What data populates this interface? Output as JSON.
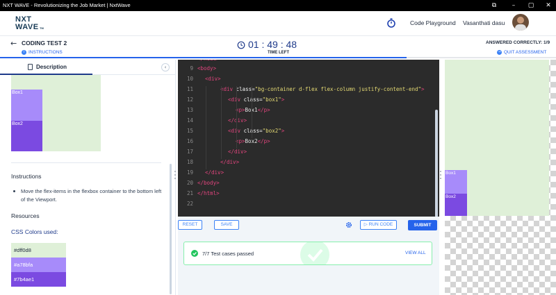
{
  "window": {
    "title": "NXT WAVE - Revolutionizing the Job Market | NxtWave"
  },
  "header": {
    "logo_line1": "NXT",
    "logo_line2": "WAVE",
    "logo_tm": "TM",
    "code_playground": "Code Playground",
    "user_name": "Vasanthati dasu"
  },
  "subheader": {
    "test_title": "CODING TEST 2",
    "instructions_link": "INSTRUCTIONS",
    "timer": "01 : 49 : 48",
    "time_left": "TIME LEFT",
    "answered": "ANSWERED CORRECTLY: 1/9",
    "quit": "QUIT ASSESSMENT"
  },
  "left_panel": {
    "tab_label": "Description",
    "preview_box1": "Box1",
    "preview_box2": "Box2",
    "instructions_title": "Instructions",
    "instruction_text": "Move the flex-items in the flexbox container to the bottom left of the Viewport.",
    "resources_title": "Resources",
    "css_colors_title": "CSS Colors used:",
    "colors": [
      {
        "hex": "#dff0d8",
        "label": "#dff0d8",
        "text_color": "#1e293b"
      },
      {
        "hex": "#a78bfa",
        "label": "#a78bfa",
        "text_color": "#ffffff"
      },
      {
        "hex": "#7b4ae1",
        "label": "#7b4ae1",
        "text_color": "#ffffff"
      }
    ]
  },
  "editor": {
    "lines": [
      {
        "n": "9",
        "parts": [
          [
            "tag",
            "<body>"
          ]
        ]
      },
      {
        "n": "10",
        "parts": [
          [
            "tag",
            "<div>"
          ]
        ]
      },
      {
        "n": "11",
        "parts": [
          [
            "tag",
            "<div "
          ],
          [
            "attr",
            "class="
          ],
          [
            "str",
            "\"bg-container d-flex flex-column justify-content-end\""
          ],
          [
            "tag",
            ">"
          ]
        ]
      },
      {
        "n": "12",
        "parts": [
          [
            "tag",
            "<div "
          ],
          [
            "attr",
            "class="
          ],
          [
            "str",
            "\"box1\""
          ],
          [
            "tag",
            ">"
          ]
        ]
      },
      {
        "n": "13",
        "parts": [
          [
            "tag",
            "<p>"
          ],
          [
            "text",
            "Box1"
          ],
          [
            "tag",
            "</p>"
          ]
        ]
      },
      {
        "n": "14",
        "parts": [
          [
            "tag",
            "</div>"
          ]
        ]
      },
      {
        "n": "15",
        "parts": [
          [
            "tag",
            "<div "
          ],
          [
            "attr",
            "class="
          ],
          [
            "str",
            "\"box2\""
          ],
          [
            "tag",
            ">"
          ]
        ]
      },
      {
        "n": "16",
        "parts": [
          [
            "tag",
            "<p>"
          ],
          [
            "text",
            "Box2"
          ],
          [
            "tag",
            "</p>"
          ]
        ]
      },
      {
        "n": "17",
        "parts": [
          [
            "tag",
            "</div>"
          ]
        ]
      },
      {
        "n": "18",
        "parts": [
          [
            "tag",
            "</div>"
          ]
        ]
      },
      {
        "n": "19",
        "parts": [
          [
            "tag",
            "</div>"
          ]
        ]
      },
      {
        "n": "20",
        "parts": [
          [
            "tag",
            "</body>"
          ]
        ]
      },
      {
        "n": "21",
        "parts": [
          [
            "tag",
            "</html>"
          ]
        ]
      },
      {
        "n": "22",
        "parts": []
      }
    ]
  },
  "controls": {
    "reset": "RESET",
    "save": "SAVE",
    "run_code": "RUN CODE",
    "submit": "SUBMIT",
    "result_text": "7/7 Test cases passed",
    "view_all": "VIEW ALL"
  },
  "right_preview": {
    "box1": "Box1",
    "box2": "Box2"
  },
  "colors": {
    "accent": "#2563eb",
    "success": "#22c55e",
    "editor_bg": "#2b2b2b"
  }
}
